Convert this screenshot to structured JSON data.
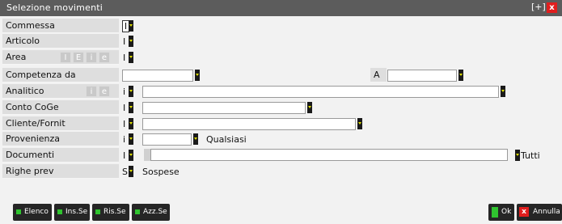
{
  "window": {
    "title": "Selezione movimenti",
    "max_label": "[+]",
    "close_label": "x"
  },
  "rows": {
    "commessa": {
      "label": "Commessa",
      "value": "I"
    },
    "articolo": {
      "label": "Articolo",
      "value": "I"
    },
    "area": {
      "label": "Area",
      "value": "I",
      "toggles": [
        "I",
        "E",
        "i",
        "e"
      ]
    },
    "competenza": {
      "label": "Competenza da",
      "value": "",
      "a_label": "A",
      "a_value": ""
    },
    "analitico": {
      "label": "Analitico",
      "value": "i",
      "toggles": [
        "i",
        "e"
      ],
      "text": ""
    },
    "conto_coge": {
      "label": "Conto CoGe",
      "value": "I",
      "text": ""
    },
    "cliente_fornit": {
      "label": "Cliente/Fornit",
      "value": "I",
      "text": ""
    },
    "provenienza": {
      "label": "Provenienza",
      "value": "i",
      "combo_value": "",
      "after": "Qualsiasi"
    },
    "documenti": {
      "label": "Documenti",
      "value": "I",
      "text": "",
      "after": "Tutti"
    },
    "righe_prev": {
      "label": "Righe prev",
      "value": "S",
      "after": "Sospese"
    }
  },
  "buttons": {
    "elenco": "Elenco",
    "ins_sel": "Ins.Se",
    "ris_sel": "Ris.Se",
    "azz_sel": "Azz.Se",
    "ok": "Ok",
    "annulla": "Annulla"
  },
  "colors": {
    "titlebar": "#5c5c5c",
    "label_bg": "#dedede",
    "accent_green": "#2fc42f",
    "close_red": "#e01e1e",
    "arrow_yellow": "#e0e000"
  }
}
